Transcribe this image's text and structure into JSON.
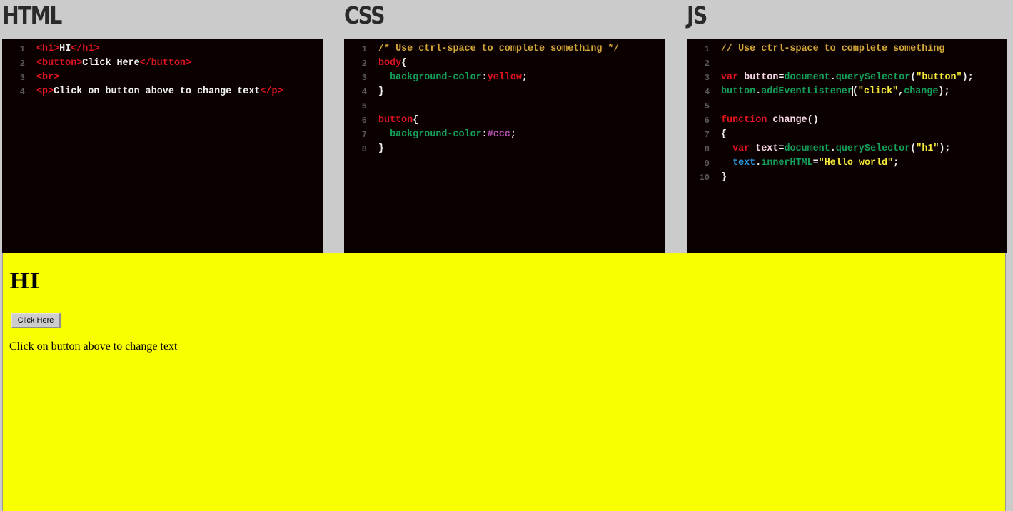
{
  "panels": {
    "html_title": "HTML",
    "css_title": "CSS",
    "js_title": "JS"
  },
  "html_editor": {
    "lines": [
      {
        "n": "1",
        "tokens": [
          [
            "tag",
            "<h1>"
          ],
          [
            "txt",
            "HI"
          ],
          [
            "tag",
            "</h1>"
          ]
        ]
      },
      {
        "n": "2",
        "tokens": [
          [
            "tag",
            "<button>"
          ],
          [
            "txt",
            "Click Here"
          ],
          [
            "tag",
            "</button>"
          ]
        ]
      },
      {
        "n": "3",
        "tokens": [
          [
            "tag",
            "<br>"
          ]
        ]
      },
      {
        "n": "4",
        "tokens": [
          [
            "tag",
            "<p>"
          ],
          [
            "txt",
            "Click on button above to change text"
          ],
          [
            "tag",
            "</p>"
          ]
        ]
      }
    ]
  },
  "css_editor": {
    "lines": [
      {
        "n": "1",
        "tokens": [
          [
            "com",
            "/* Use ctrl-space to complete something */"
          ]
        ]
      },
      {
        "n": "2",
        "tokens": [
          [
            "val",
            "body"
          ],
          [
            "txt",
            "{"
          ]
        ]
      },
      {
        "n": "3",
        "tokens": [
          [
            "txt",
            "  "
          ],
          [
            "prop",
            "background-color"
          ],
          [
            "txt",
            ":"
          ],
          [
            "val",
            "yellow"
          ],
          [
            "txt",
            ";"
          ]
        ]
      },
      {
        "n": "4",
        "tokens": [
          [
            "txt",
            "}"
          ]
        ]
      },
      {
        "n": "5",
        "tokens": []
      },
      {
        "n": "6",
        "tokens": [
          [
            "val",
            "button"
          ],
          [
            "txt",
            "{"
          ]
        ]
      },
      {
        "n": "7",
        "tokens": [
          [
            "txt",
            "  "
          ],
          [
            "prop",
            "background-color"
          ],
          [
            "txt",
            ":"
          ],
          [
            "hex",
            "#ccc"
          ],
          [
            "txt",
            ";"
          ]
        ]
      },
      {
        "n": "8",
        "tokens": [
          [
            "txt",
            "}"
          ]
        ]
      }
    ]
  },
  "js_editor": {
    "lines": [
      {
        "n": "1",
        "tokens": [
          [
            "com",
            "// Use ctrl-space to complete something"
          ]
        ]
      },
      {
        "n": "2",
        "tokens": []
      },
      {
        "n": "3",
        "tokens": [
          [
            "kw",
            "var"
          ],
          [
            "txt",
            " "
          ],
          [
            "id",
            "button"
          ],
          [
            "txt",
            "="
          ],
          [
            "fn",
            "document"
          ],
          [
            "txt",
            "."
          ],
          [
            "fn",
            "querySelector"
          ],
          [
            "txt",
            "("
          ],
          [
            "str",
            "\"button\""
          ],
          [
            "txt",
            ");"
          ]
        ]
      },
      {
        "n": "4",
        "tokens": [
          [
            "fn",
            "button"
          ],
          [
            "txt",
            "."
          ],
          [
            "fn",
            "addEventListener"
          ],
          [
            "cursor",
            ""
          ],
          [
            "txt",
            "("
          ],
          [
            "str",
            "\"click\""
          ],
          [
            "txt",
            ","
          ],
          [
            "fn",
            "change"
          ],
          [
            "txt",
            ");"
          ]
        ]
      },
      {
        "n": "5",
        "tokens": []
      },
      {
        "n": "6",
        "tokens": [
          [
            "kw",
            "function"
          ],
          [
            "txt",
            " "
          ],
          [
            "id",
            "change"
          ],
          [
            "txt",
            "()"
          ]
        ]
      },
      {
        "n": "7",
        "tokens": [
          [
            "txt",
            "{"
          ]
        ]
      },
      {
        "n": "8",
        "tokens": [
          [
            "txt",
            "  "
          ],
          [
            "kw",
            "var"
          ],
          [
            "txt",
            " "
          ],
          [
            "id",
            "text"
          ],
          [
            "txt",
            "="
          ],
          [
            "fn",
            "document"
          ],
          [
            "txt",
            "."
          ],
          [
            "fn",
            "querySelector"
          ],
          [
            "txt",
            "("
          ],
          [
            "str",
            "\"h1\""
          ],
          [
            "txt",
            ");"
          ]
        ]
      },
      {
        "n": "9",
        "tokens": [
          [
            "txt",
            "  "
          ],
          [
            "var",
            "text"
          ],
          [
            "txt",
            "."
          ],
          [
            "fn",
            "innerHTML"
          ],
          [
            "txt",
            "="
          ],
          [
            "str",
            "\"Hello world\""
          ],
          [
            "txt",
            ";"
          ]
        ]
      },
      {
        "n": "10",
        "tokens": [
          [
            "txt",
            "}"
          ]
        ]
      }
    ]
  },
  "preview": {
    "background": "#f7ff00",
    "heading": "HI",
    "button_label": "Click Here",
    "paragraph": "Click on button above to change text"
  },
  "colors": {
    "editor_bg": "#0b0000",
    "tag": "#e0141e",
    "comment": "#d2a637",
    "property": "#14a05a",
    "string": "#f5e93a",
    "hex": "#b64fb3",
    "variable": "#2a9be5"
  }
}
